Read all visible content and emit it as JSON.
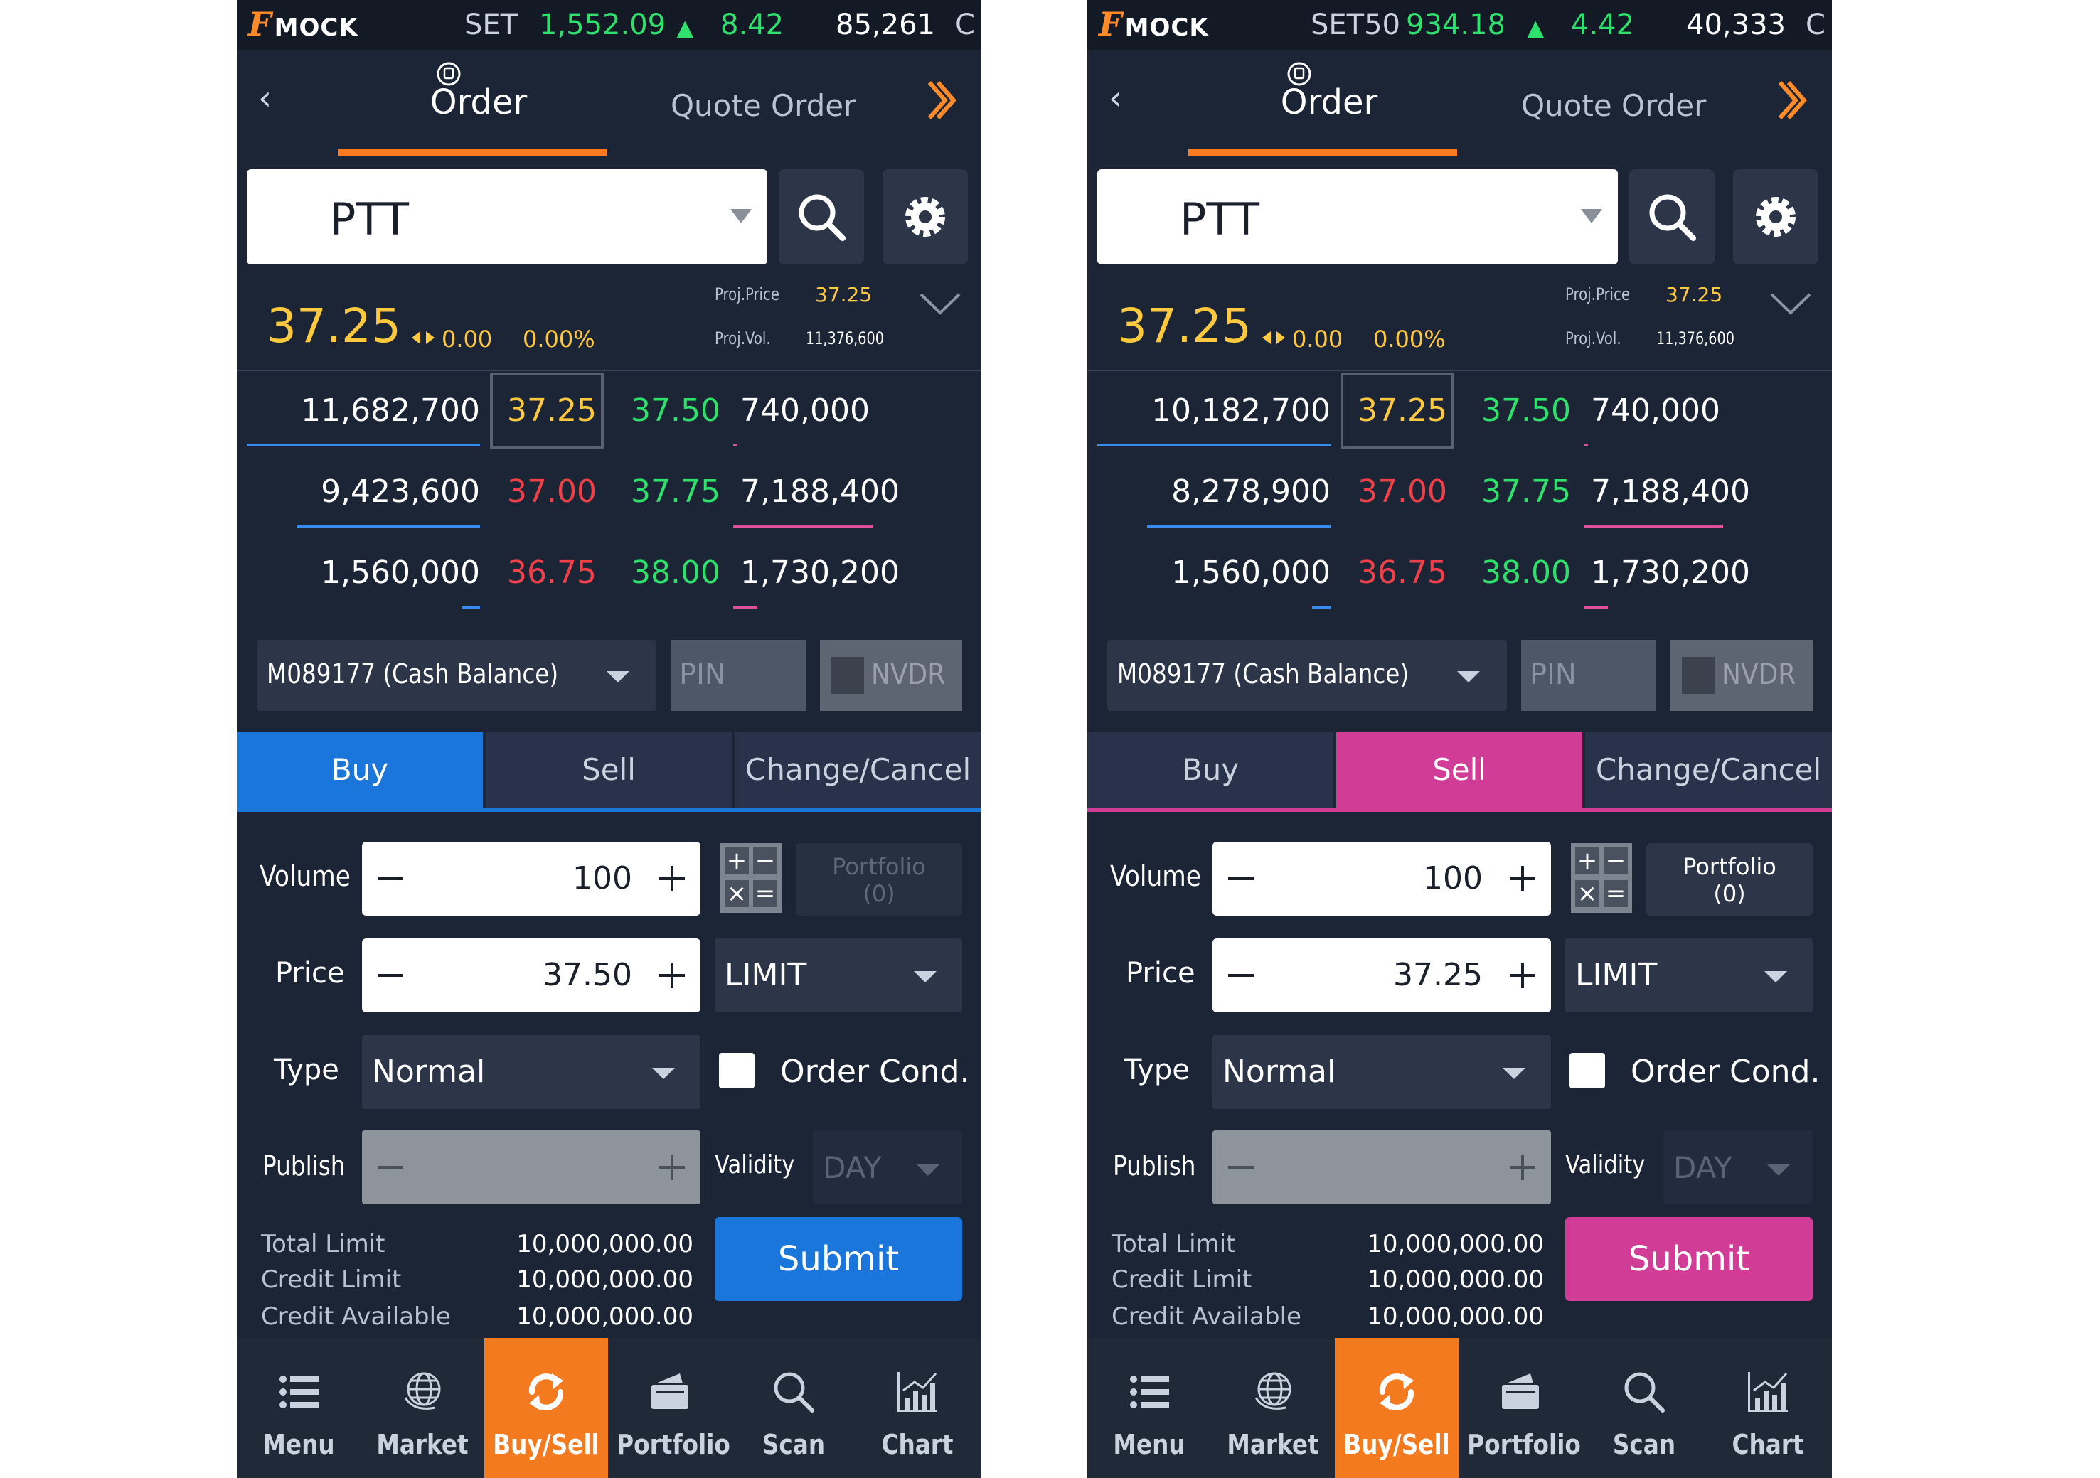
{
  "screens": [
    {
      "id": "left",
      "ticker": {
        "logo": "MOCK",
        "index": "SET",
        "value": "1,552.09",
        "arrow": "▲",
        "change": "8.42",
        "volume": "85,261",
        "cut": "C"
      },
      "header": {
        "back": "‹",
        "active_tab": "Order",
        "other_tab": "Quote Order"
      },
      "symbol": "PTT",
      "summary": {
        "last": "37.25",
        "change": "0.00",
        "pct": "0.00%",
        "proj_price_label": "Proj.Price",
        "proj_price": "37.25",
        "proj_vol_label": "Proj.Vol.",
        "proj_vol": "11,376,600"
      },
      "depth": [
        {
          "bid_vol": "11,682,700",
          "bid": "37.25",
          "ask": "37.50",
          "ask_vol": "740,000"
        },
        {
          "bid_vol": "9,423,600",
          "bid": "37.00",
          "ask": "37.75",
          "ask_vol": "7,188,400"
        },
        {
          "bid_vol": "1,560,000",
          "bid": "36.75",
          "ask": "38.00",
          "ask_vol": "1,730,200"
        }
      ],
      "account": "M089177 (Cash Balance)",
      "pin_placeholder": "PIN",
      "nvdr_label": "NVDR",
      "tabs": {
        "buy": "Buy",
        "sell": "Sell",
        "change": "Change/Cancel",
        "active": "buy"
      },
      "form": {
        "volume_label": "Volume",
        "volume": "100",
        "price_label": "Price",
        "price": "37.50",
        "price_type": "LIMIT",
        "type_label": "Type",
        "type": "Normal",
        "order_cond": "Order Cond.",
        "publish_label": "Publish",
        "validity_label": "Validity",
        "validity": "DAY",
        "portfolio_label": "Portfolio",
        "portfolio_count": "(0)",
        "calc": [
          "+",
          "−",
          "×",
          "="
        ]
      },
      "limits": [
        {
          "label": "Total Limit",
          "value": "10,000,000.00"
        },
        {
          "label": "Credit Limit",
          "value": "10,000,000.00"
        },
        {
          "label": "Credit Available",
          "value": "10,000,000.00"
        }
      ],
      "submit": "Submit",
      "nav": [
        "Menu",
        "Market",
        "Buy/Sell",
        "Portfolio",
        "Scan",
        "Chart"
      ],
      "accent": "#1b76db"
    },
    {
      "id": "right",
      "ticker": {
        "logo": "MOCK",
        "index": "SET50",
        "value": "934.18",
        "arrow": "▲",
        "change": "4.42",
        "volume": "40,333",
        "cut": "C"
      },
      "header": {
        "back": "‹",
        "active_tab": "Order",
        "other_tab": "Quote Order"
      },
      "symbol": "PTT",
      "summary": {
        "last": "37.25",
        "change": "0.00",
        "pct": "0.00%",
        "proj_price_label": "Proj.Price",
        "proj_price": "37.25",
        "proj_vol_label": "Proj.Vol.",
        "proj_vol": "11,376,600"
      },
      "depth": [
        {
          "bid_vol": "10,182,700",
          "bid": "37.25",
          "ask": "37.50",
          "ask_vol": "740,000"
        },
        {
          "bid_vol": "8,278,900",
          "bid": "37.00",
          "ask": "37.75",
          "ask_vol": "7,188,400"
        },
        {
          "bid_vol": "1,560,000",
          "bid": "36.75",
          "ask": "38.00",
          "ask_vol": "1,730,200"
        }
      ],
      "account": "M089177 (Cash Balance)",
      "pin_placeholder": "PIN",
      "nvdr_label": "NVDR",
      "tabs": {
        "buy": "Buy",
        "sell": "Sell",
        "change": "Change/Cancel",
        "active": "sell"
      },
      "form": {
        "volume_label": "Volume",
        "volume": "100",
        "price_label": "Price",
        "price": "37.25",
        "price_type": "LIMIT",
        "type_label": "Type",
        "type": "Normal",
        "order_cond": "Order Cond.",
        "publish_label": "Publish",
        "validity_label": "Validity",
        "validity": "DAY",
        "portfolio_label": "Portfolio",
        "portfolio_count": "(0)",
        "calc": [
          "+",
          "−",
          "×",
          "="
        ]
      },
      "limits": [
        {
          "label": "Total Limit",
          "value": "10,000,000.00"
        },
        {
          "label": "Credit Limit",
          "value": "10,000,000.00"
        },
        {
          "label": "Credit Available",
          "value": "10,000,000.00"
        }
      ],
      "submit": "Submit",
      "nav": [
        "Menu",
        "Market",
        "Buy/Sell",
        "Portfolio",
        "Scan",
        "Chart"
      ],
      "accent": "#d13c96"
    }
  ],
  "colors": {
    "bid_color": "#f0414b",
    "best_bid_color": "#ffc93f",
    "ask_color": "#2fe06d",
    "nav_active": "#f47a20"
  }
}
